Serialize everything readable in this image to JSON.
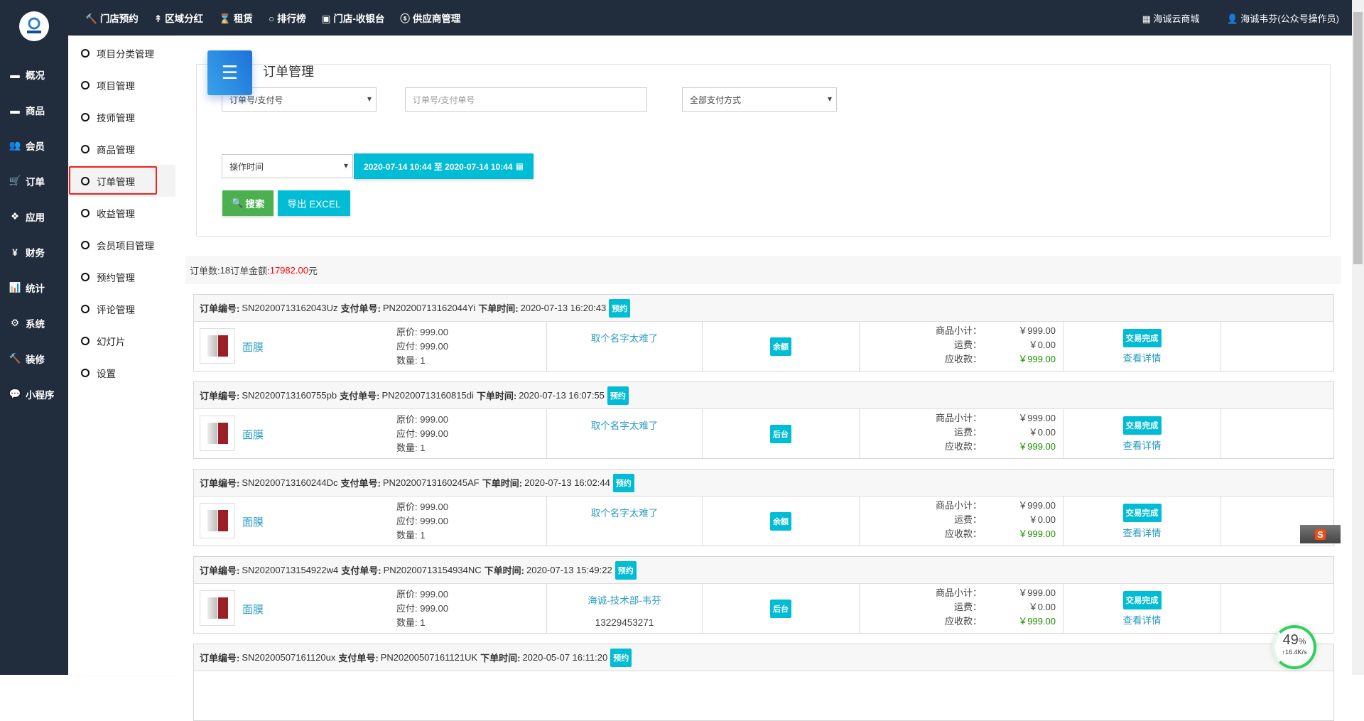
{
  "topnav": [
    {
      "icon": "hammer-icon",
      "glyph": "🔨",
      "label": "门店预约"
    },
    {
      "icon": "pin-icon",
      "glyph": "↟",
      "label": "区域分红"
    },
    {
      "icon": "hourglass-icon",
      "glyph": "⌛",
      "label": "租赁"
    },
    {
      "icon": "circle-icon",
      "glyph": "○",
      "label": "排行榜"
    },
    {
      "icon": "cash-icon",
      "glyph": "▣",
      "label": "门店-收银台"
    },
    {
      "icon": "skype-icon",
      "glyph": "ⓢ",
      "label": "供应商管理"
    }
  ],
  "topright": {
    "shop": "海诚云商城",
    "user": "海诚韦芬(公众号操作员)"
  },
  "leftbar": [
    {
      "glyph": "▬",
      "icon": "archive-icon",
      "label": "概况"
    },
    {
      "glyph": "▬",
      "icon": "archive-icon",
      "label": "商品"
    },
    {
      "glyph": "👥",
      "icon": "users-icon",
      "label": "会员"
    },
    {
      "glyph": "🛒",
      "icon": "cart-icon",
      "label": "订单"
    },
    {
      "glyph": "❖",
      "icon": "cubes-icon",
      "label": "应用"
    },
    {
      "glyph": "¥",
      "icon": "yen-icon",
      "label": "财务"
    },
    {
      "glyph": "📊",
      "icon": "chart-icon",
      "label": "统计"
    },
    {
      "glyph": "⚙",
      "icon": "gears-icon",
      "label": "系统"
    },
    {
      "glyph": "🔨",
      "icon": "hammer-icon",
      "label": "装修"
    },
    {
      "glyph": "💬",
      "icon": "wechat-icon",
      "label": "小程序"
    }
  ],
  "submenu": [
    "项目分类管理",
    "项目管理",
    "技师管理",
    "商品管理",
    "订单管理",
    "收益管理",
    "会员项目管理",
    "预约管理",
    "评论管理",
    "幻灯片",
    "设置"
  ],
  "submenu_active": 4,
  "panel": {
    "title": "订单管理",
    "search_type": "订单号/支付号",
    "search_placeholder": "订单号/支付单号",
    "pay_method": "全部支付方式",
    "time_type": "操作时间",
    "date_range": "2020-07-14 10:44 至 2020-07-14 10:44",
    "search_btn": "搜索",
    "export_btn": "导出 EXCEL"
  },
  "summary": {
    "count_label": "订单数: ",
    "count": "18",
    "amount_label": " 订单金额: ",
    "amount": "17982.00",
    "unit": "元"
  },
  "labels": {
    "order_no": "订单编号:",
    "pay_no": "支付单号:",
    "time": "下单时间:",
    "orig": "原价: ",
    "pay": "应付: ",
    "qty": "数量: ",
    "subtotal": "商品小计：",
    "freight": "运费：",
    "receivable": "应收款：",
    "detail": "查看详情"
  },
  "orders": [
    {
      "sn": "SN20200713162043Uz",
      "pn": "PN20200713162044Yi",
      "time": "2020-07-13 16:20:43",
      "type": "预约",
      "product": "面膜",
      "orig": "999.00",
      "pay": "999.00",
      "qty": "1",
      "staff": "取个名字太难了",
      "phone": "",
      "method": "余额",
      "subtotal": "￥999.00",
      "freight": "￥0.00",
      "receivable": "￥999.00",
      "status": "交易完成"
    },
    {
      "sn": "SN20200713160755pb",
      "pn": "PN20200713160815di",
      "time": "2020-07-13 16:07:55",
      "type": "预约",
      "product": "面膜",
      "orig": "999.00",
      "pay": "999.00",
      "qty": "1",
      "staff": "取个名字太难了",
      "phone": "",
      "method": "后台",
      "subtotal": "￥999.00",
      "freight": "￥0.00",
      "receivable": "￥999.00",
      "status": "交易完成"
    },
    {
      "sn": "SN20200713160244Dc",
      "pn": "PN20200713160245AF",
      "time": "2020-07-13 16:02:44",
      "type": "预约",
      "product": "面膜",
      "orig": "999.00",
      "pay": "999.00",
      "qty": "1",
      "staff": "取个名字太难了",
      "phone": "",
      "method": "余额",
      "subtotal": "￥999.00",
      "freight": "￥0.00",
      "receivable": "￥999.00",
      "status": "交易完成"
    },
    {
      "sn": "SN20200713154922w4",
      "pn": "PN20200713154934NC",
      "time": "2020-07-13 15:49:22",
      "type": "预约",
      "product": "面膜",
      "orig": "999.00",
      "pay": "999.00",
      "qty": "1",
      "staff": "海诚-技术部-韦芬",
      "phone": "13229453271",
      "method": "后台",
      "subtotal": "￥999.00",
      "freight": "￥0.00",
      "receivable": "￥999.00",
      "status": "交易完成"
    },
    {
      "sn": "SN20200507161120ux",
      "pn": "PN20200507161121UK",
      "time": "2020-05-07 16:11:20",
      "type": "预约"
    }
  ],
  "ime": {
    "label": "S"
  },
  "speed": {
    "percent": "49",
    "unit": "%",
    "rate": "↑16.4K/s"
  },
  "colors": {
    "nav": "#212c3c",
    "accent": "#00bcd4",
    "success": "#4caf50",
    "amount": "#ff0000"
  }
}
